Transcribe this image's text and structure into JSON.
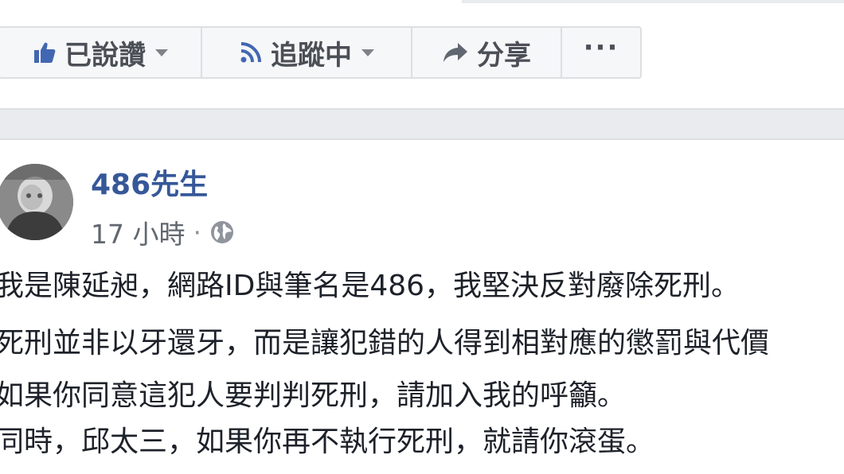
{
  "actions": {
    "liked_label": "已說讚",
    "following_label": "追蹤中",
    "share_label": "分享",
    "more_label": "···"
  },
  "post": {
    "author": "486先生",
    "time": "17 小時",
    "separator": "·",
    "lines": [
      "我是陳延昶，網路ID與筆名是486，我堅決反對廢除死刑。",
      "死刑並非以牙還牙，而是讓犯錯的人得到相對應的懲罰與代價",
      "如果你同意這犯人要判判死刑，請加入我的呼籲。",
      "同時，邱太三，如果你再不執行死刑，就請你滾蛋。"
    ]
  },
  "icons": {
    "like": "thumbs-up-icon",
    "follow": "rss-icon",
    "share": "share-arrow-icon",
    "privacy": "globe-icon",
    "dropdown": "chevron-down-icon"
  },
  "colors": {
    "accent": "#365899",
    "like_blue": "#4267b2",
    "text": "#1d2129",
    "muted": "#616770",
    "border": "#dddfe2",
    "band": "#e9ebee"
  }
}
